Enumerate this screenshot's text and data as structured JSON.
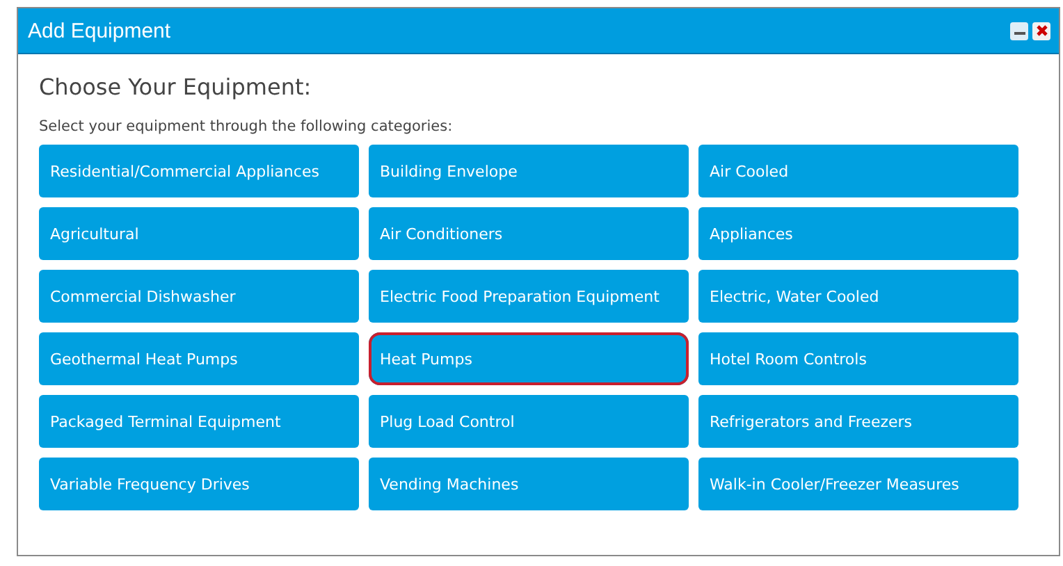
{
  "window": {
    "title": "Add Equipment"
  },
  "heading": "Choose Your Equipment:",
  "instruction": "Select your equipment through the following categories:",
  "categories": [
    {
      "label": "Residential/Commercial Appliances",
      "selected": false
    },
    {
      "label": "Building Envelope",
      "selected": false
    },
    {
      "label": "Air Cooled",
      "selected": false
    },
    {
      "label": "Agricultural",
      "selected": false
    },
    {
      "label": "Air Conditioners",
      "selected": false
    },
    {
      "label": "Appliances",
      "selected": false
    },
    {
      "label": "Commercial Dishwasher",
      "selected": false
    },
    {
      "label": "Electric Food Preparation Equipment",
      "selected": false
    },
    {
      "label": "Electric, Water Cooled",
      "selected": false
    },
    {
      "label": "Geothermal Heat Pumps",
      "selected": false
    },
    {
      "label": "Heat Pumps",
      "selected": true
    },
    {
      "label": "Hotel Room Controls",
      "selected": false
    },
    {
      "label": "Packaged Terminal Equipment",
      "selected": false
    },
    {
      "label": "Plug Load Control",
      "selected": false
    },
    {
      "label": "Refrigerators and Freezers",
      "selected": false
    },
    {
      "label": "Variable Frequency Drives",
      "selected": false
    },
    {
      "label": "Vending Machines",
      "selected": false
    },
    {
      "label": "Walk-in Cooler/Freezer Measures",
      "selected": false
    }
  ]
}
